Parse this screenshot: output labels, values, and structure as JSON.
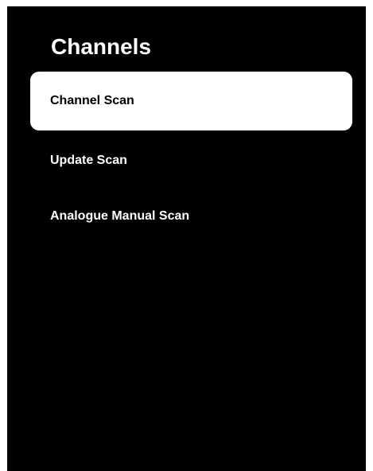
{
  "screen": {
    "title": "Channels"
  },
  "menu": {
    "items": [
      {
        "label": "Channel Scan",
        "selected": true
      },
      {
        "label": "Update Scan",
        "selected": false
      },
      {
        "label": "Analogue Manual Scan",
        "selected": false
      }
    ]
  },
  "colors": {
    "background": "#000000",
    "text": "#ffffff",
    "selected_background": "#ffffff",
    "selected_text": "#000000"
  }
}
